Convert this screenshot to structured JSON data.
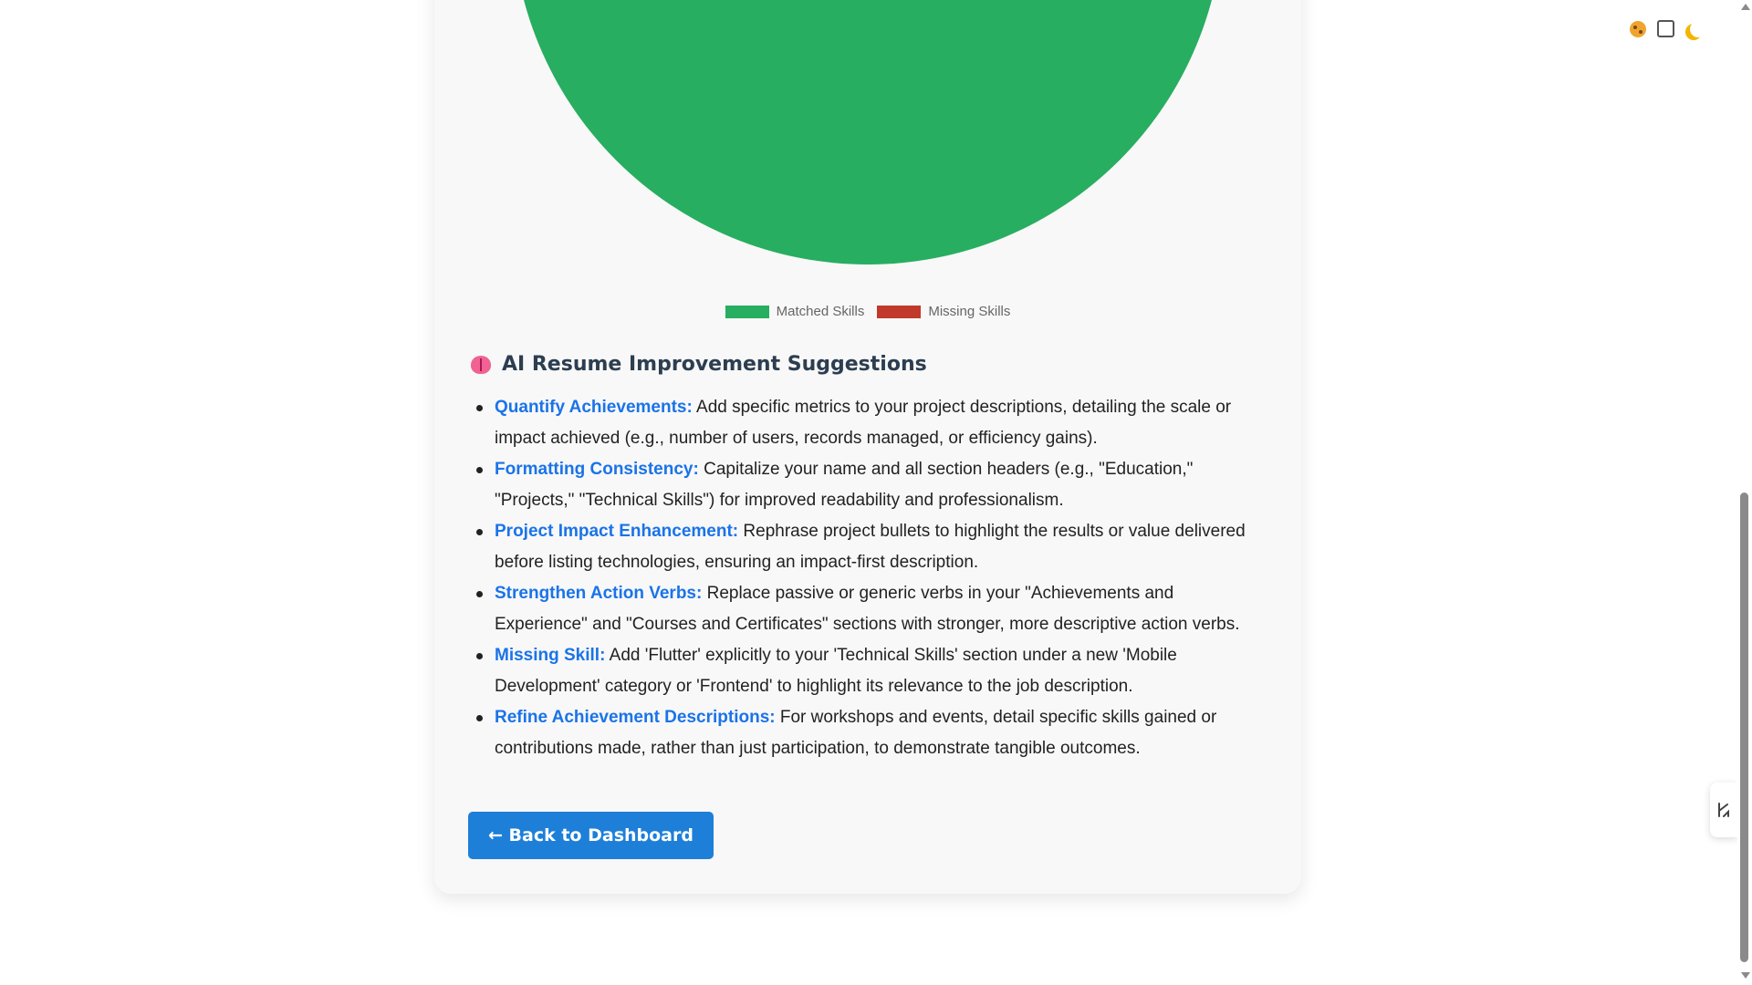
{
  "chart_data": {
    "type": "pie",
    "series": [
      {
        "name": "Matched Skills",
        "value": 1,
        "color": "#27ae60"
      },
      {
        "name": "Missing Skills",
        "value": 0,
        "color": "#c0392b"
      }
    ],
    "legend_position": "bottom"
  },
  "legend": {
    "matched_label": "Matched Skills",
    "missing_label": "Missing Skills",
    "matched_color": "#27ae60",
    "missing_color": "#c0392b"
  },
  "suggestions_section": {
    "title": "AI Resume Improvement Suggestions",
    "icon": "brain-icon",
    "items": [
      {
        "title": "Quantify Achievements:",
        "text": " Add specific metrics to your project descriptions, detailing the scale or impact achieved (e.g., number of users, records managed, or efficiency gains)."
      },
      {
        "title": "Formatting Consistency:",
        "text": " Capitalize your name and all section headers (e.g., \"Education,\" \"Projects,\" \"Technical Skills\") for improved readability and professionalism."
      },
      {
        "title": "Project Impact Enhancement:",
        "text": " Rephrase project bullets to highlight the results or value delivered before listing technologies, ensuring an impact-first description."
      },
      {
        "title": "Strengthen Action Verbs:",
        "text": " Replace passive or generic verbs in your \"Achievements and Experience\" and \"Courses and Certificates\" sections with stronger, more descriptive action verbs."
      },
      {
        "title": "Missing Skill:",
        "text": " Add 'Flutter' explicitly to your 'Technical Skills' section under a new 'Mobile Development' category or 'Frontend' to highlight its relevance to the job description."
      },
      {
        "title": "Refine Achievement Descriptions:",
        "text": " For workshops and events, detail specific skills gained or contributions made, rather than just participation, to demonstrate tangible outcomes."
      }
    ]
  },
  "back_button": {
    "label": "← Back to Dashboard"
  },
  "toolbar_icons": [
    "cookie-icon",
    "square-icon",
    "moon-icon"
  ],
  "side_tab_icon": "scribble-icon",
  "colors": {
    "accent": "#1e7fd8",
    "link": "#1a73e8",
    "heading": "#2c3e50"
  }
}
